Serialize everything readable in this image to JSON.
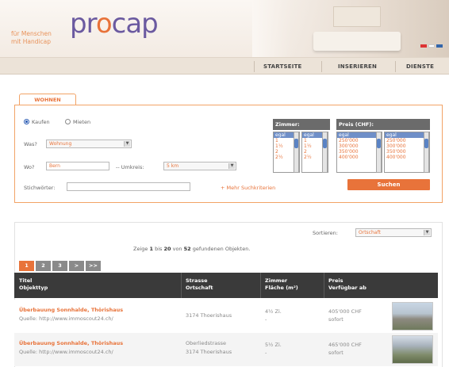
{
  "header": {
    "tagline_line1": "für Menschen",
    "tagline_line2": "mit Handicap",
    "logo_pre": "pr",
    "logo_o": "o",
    "logo_post": "cap"
  },
  "nav": {
    "items": [
      "STARTSEITE",
      "INSERIEREN",
      "DIENSTE"
    ]
  },
  "search": {
    "tab_label": "WOHNEN",
    "radio_kaufen": "Kaufen",
    "radio_mieten": "Mieten",
    "was_label": "Was?",
    "was_value": "Wohnung",
    "wo_label": "Wo?",
    "wo_value": "Bern",
    "umkreis_label": "-- Umkreis:",
    "umkreis_value": "5 km",
    "stichwort_label": "Stichwörter:",
    "stichwort_value": "",
    "more_link": "+ Mehr Suchkriterien",
    "zimmer_header": "Zimmer:",
    "zimmer_min": [
      "egal",
      "1",
      "1½",
      "2",
      "2½"
    ],
    "zimmer_max": [
      "egal",
      "1",
      "1½",
      "2",
      "2½"
    ],
    "preis_header": "Preis (CHF):",
    "preis_min": [
      "egal",
      "250'000",
      "300'000",
      "350'000",
      "400'000"
    ],
    "preis_max": [
      "egal",
      "250'000",
      "300'000",
      "350'000",
      "400'000"
    ],
    "button": "Suchen"
  },
  "results": {
    "sort_label": "Sortieren:",
    "sort_value": "Ortschaft",
    "summary_pre": "Zeige",
    "from": "1",
    "mid1": "bis",
    "to": "20",
    "mid2": "von",
    "total": "52",
    "summary_post": "gefundenen Objekten.",
    "pages": [
      "1",
      "2",
      "3",
      ">",
      ">>"
    ],
    "columns": {
      "c1_line1": "Titel",
      "c1_line2": "Objekttyp",
      "c2_line1": "Strasse",
      "c2_line2": "Ortschaft",
      "c3_line1": "Zimmer",
      "c3_line2": "Fläche (m²)",
      "c4_line1": "Preis",
      "c4_line2": "Verfügbar ab"
    },
    "rows": [
      {
        "title": "Überbauung Sonnhalde, Thörishaus",
        "source": "Quelle: http://www.immoscout24.ch/",
        "street": "",
        "town": "3174 Thoerishaus",
        "rooms": "4½ Zi.",
        "area": "-",
        "price": "405'000 CHF",
        "available": "sofort"
      },
      {
        "title": "Überbauung Sonnhalde, Thörishaus",
        "source": "Quelle: http://www.immoscout24.ch/",
        "street": "Oberliedstrasse",
        "town": "3174 Thoerishaus",
        "rooms": "5½ Zi.",
        "area": "-",
        "price": "465'000 CHF",
        "available": "sofort"
      }
    ]
  }
}
